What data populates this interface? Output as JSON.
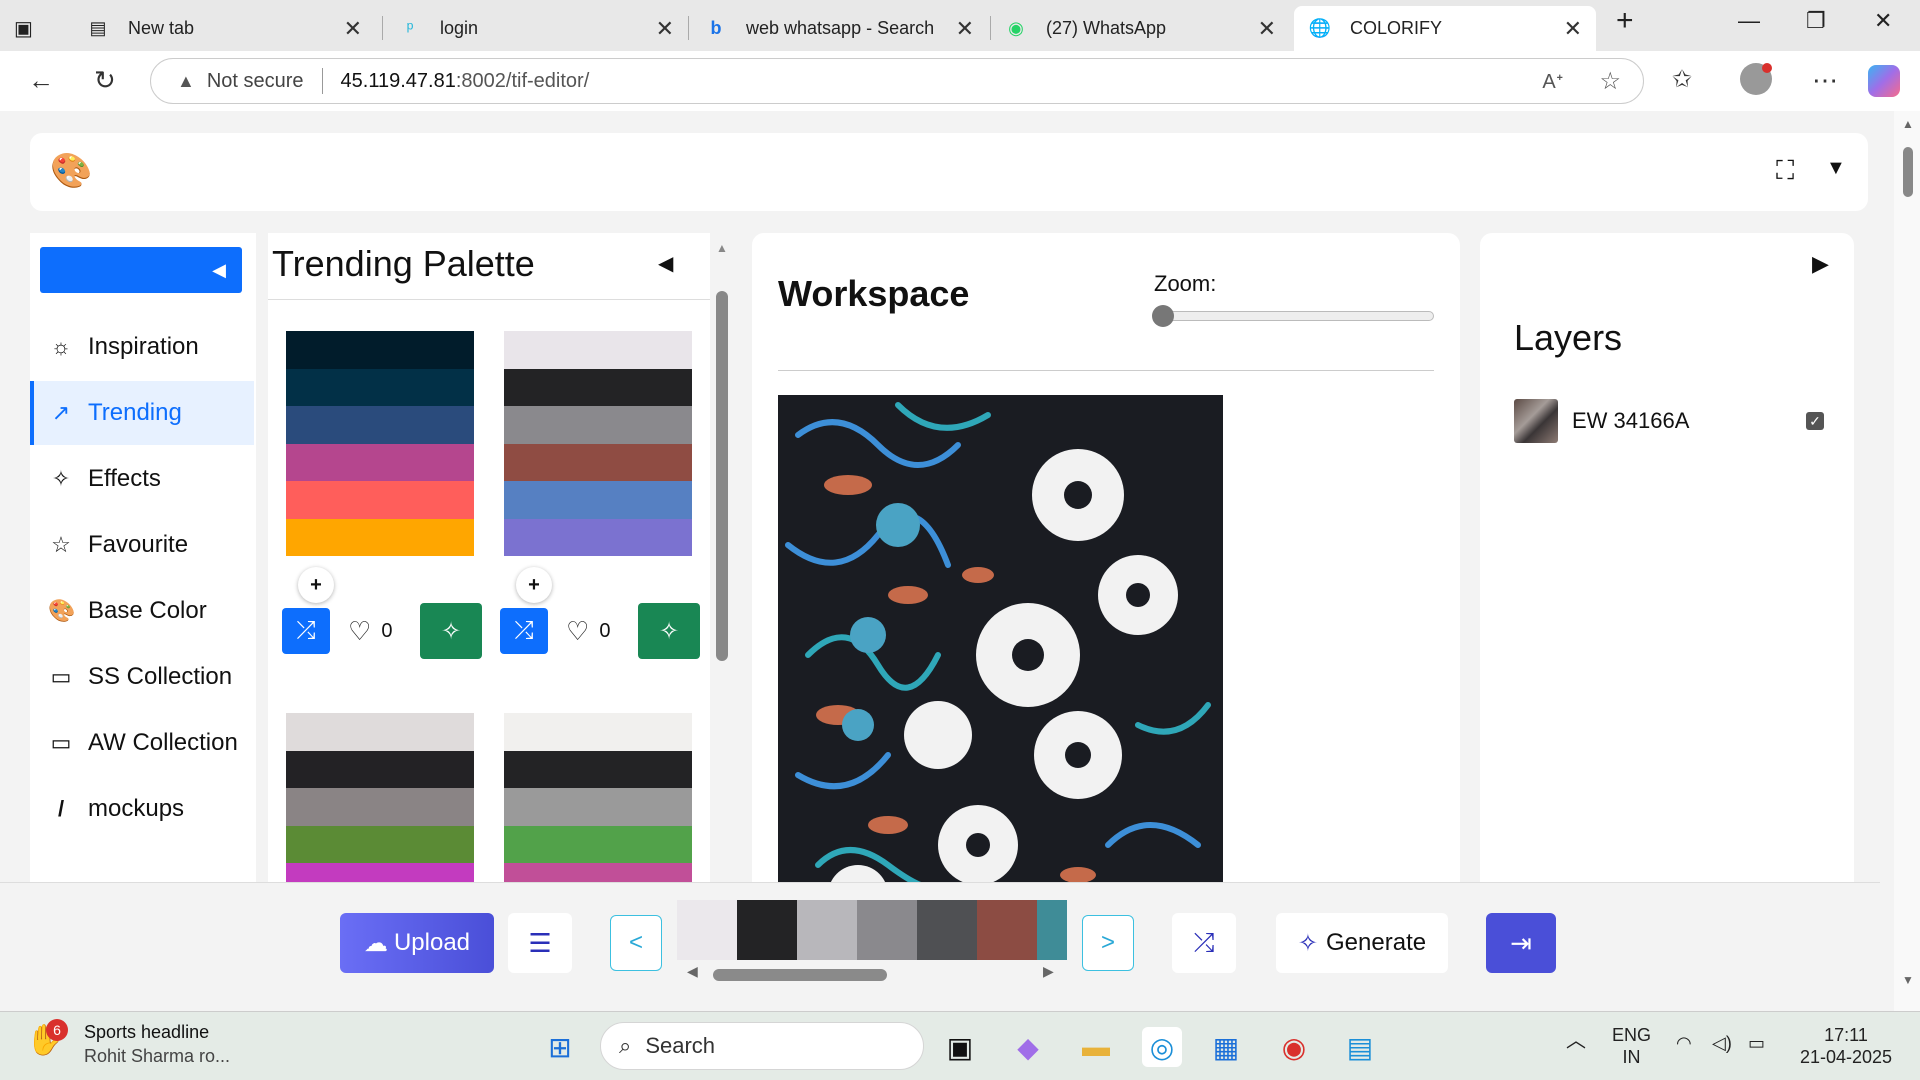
{
  "browser": {
    "tabs": [
      {
        "title": "New tab",
        "icon": "newtab-icon"
      },
      {
        "title": "login",
        "icon": "tplink-icon"
      },
      {
        "title": "web whatsapp - Search",
        "icon": "bing-icon"
      },
      {
        "title": "(27) WhatsApp",
        "icon": "whatsapp-icon"
      },
      {
        "title": "COLORIFY",
        "icon": "globe-icon"
      }
    ],
    "security_label": "Not secure",
    "url_host": "45.119.47.81",
    "url_path": ":8002/tif-editor/"
  },
  "sidebar": {
    "items": [
      {
        "label": "Inspiration",
        "icon": "sunrise-icon",
        "glyph": "☼"
      },
      {
        "label": "Trending",
        "icon": "trending-icon",
        "glyph": "↗"
      },
      {
        "label": "Effects",
        "icon": "magic-wand-icon",
        "glyph": "✧"
      },
      {
        "label": "Favourite",
        "icon": "star-icon",
        "glyph": "☆"
      },
      {
        "label": "Base Color",
        "icon": "palette-icon",
        "glyph": "🎨"
      },
      {
        "label": "SS Collection",
        "icon": "collection-icon",
        "glyph": "▭"
      },
      {
        "label": "AW Collection",
        "icon": "collection-icon",
        "glyph": "▭"
      },
      {
        "label": "mockups",
        "icon": "brush-icon",
        "glyph": "/"
      }
    ],
    "active": "Trending"
  },
  "palettes": {
    "title": "Trending Palette",
    "cards": [
      {
        "colors": [
          "#011c2b",
          "#023047",
          "#2a4b7c",
          "#b5468e",
          "#ff5e5b",
          "#ffa600"
        ],
        "likes": "0"
      },
      {
        "colors": [
          "#e9e5ea",
          "#232325",
          "#8a898d",
          "#8f4c43",
          "#5680c2",
          "#7b72d0"
        ],
        "likes": "0"
      },
      {
        "colors": [
          "#dfdbdb",
          "#232225",
          "#8a8485",
          "#5b8b35",
          "#c33bbf"
        ],
        "likes": ""
      },
      {
        "colors": [
          "#f1f0ee",
          "#232325",
          "#9a9a9a",
          "#52a24a",
          "#c14f98"
        ],
        "likes": ""
      }
    ]
  },
  "workspace": {
    "title": "Workspace",
    "zoom_label": "Zoom:"
  },
  "layers": {
    "title": "Layers",
    "items": [
      {
        "name": "EW 34166A",
        "checked": true
      }
    ]
  },
  "toolbar": {
    "upload_label": "Upload",
    "prev_label": "<",
    "next_label": ">",
    "generate_label": "Generate",
    "strip_colors": [
      "#ebe8ec",
      "#232325",
      "#b8b7bb",
      "#8a898d",
      "#4f5053",
      "#8c4c43",
      "#3f8c97"
    ]
  },
  "taskbar": {
    "news_badge": "6",
    "news_title": "Sports headline",
    "news_sub": "Rohit Sharma ro...",
    "search_placeholder": "Search",
    "lang_line1": "ENG",
    "lang_line2": "IN",
    "time": "17:11",
    "date": "21-04-2025"
  }
}
